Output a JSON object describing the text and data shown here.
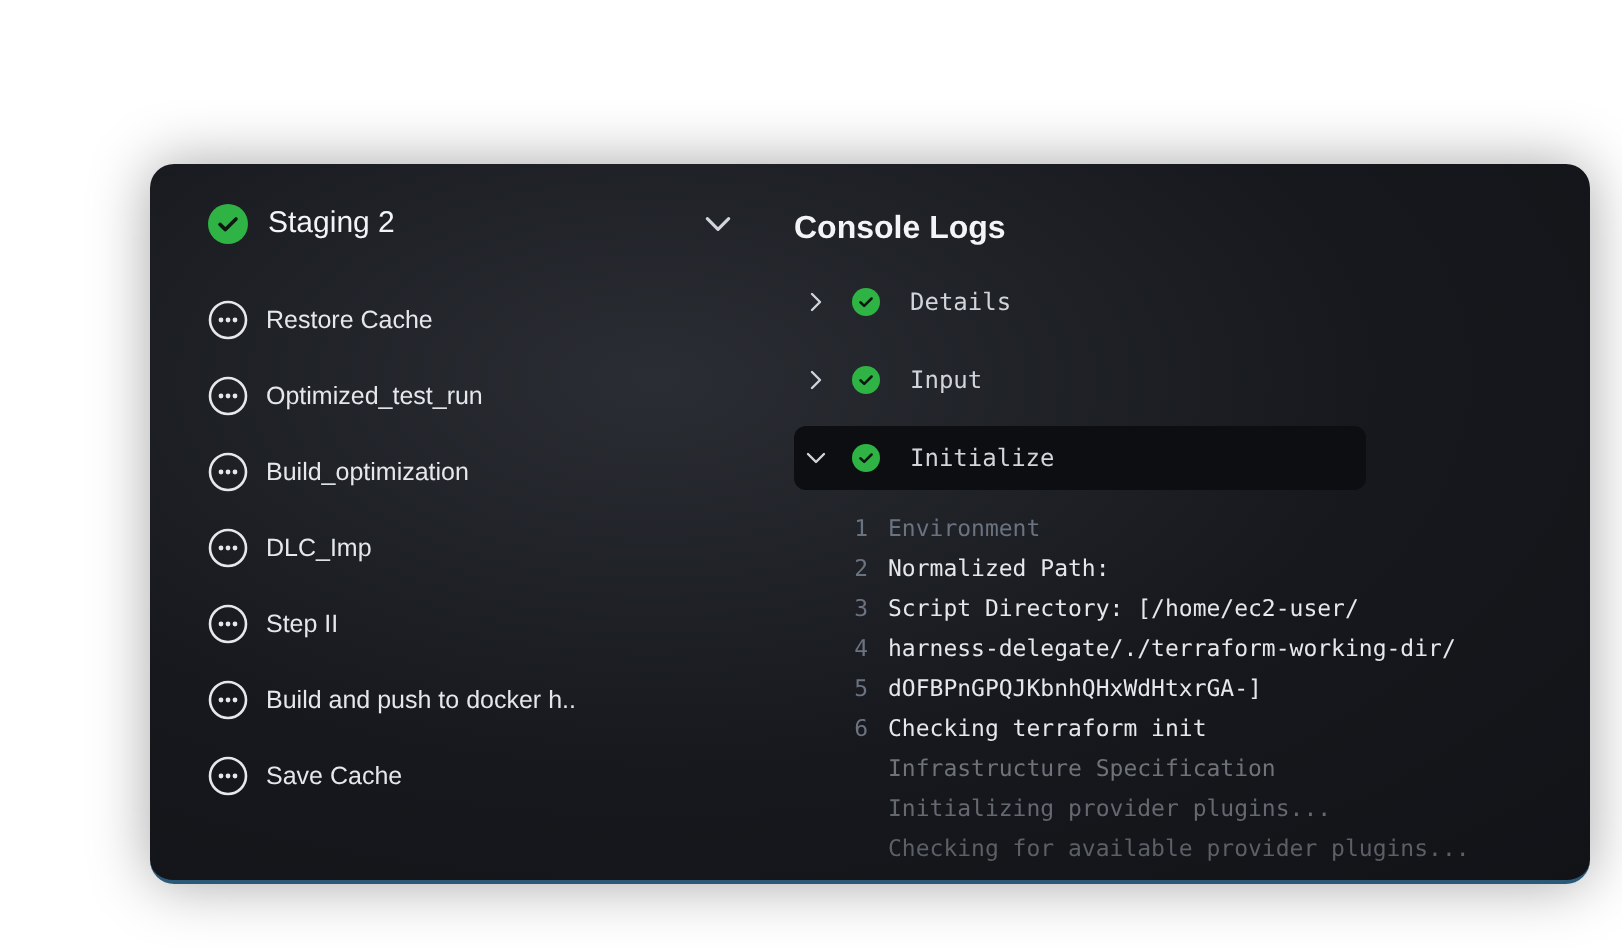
{
  "stage": {
    "title": "Staging 2",
    "kind": "success",
    "expanded": true
  },
  "steps": [
    {
      "label": "Restore Cache",
      "kind": "pending"
    },
    {
      "label": "Optimized_test_run",
      "kind": "pending"
    },
    {
      "label": "Build_optimization",
      "kind": "pending"
    },
    {
      "label": "DLC_Imp",
      "kind": "pending"
    },
    {
      "label": "Step II",
      "kind": "pending"
    },
    {
      "label": "Build and push to docker h..",
      "kind": "pending"
    },
    {
      "label": "Save Cache",
      "kind": "pending"
    }
  ],
  "console": {
    "title": "Console Logs",
    "sections": [
      {
        "label": "Details",
        "kind": "success",
        "expanded": false,
        "selected": false
      },
      {
        "label": "Input",
        "kind": "success",
        "expanded": false,
        "selected": false
      },
      {
        "label": "Initialize",
        "kind": "success",
        "expanded": true,
        "selected": true
      }
    ],
    "lines": [
      {
        "number": "1",
        "text": "Environment",
        "kind": "dim"
      },
      {
        "number": "2",
        "text": "Normalized Path:",
        "kind": "bright"
      },
      {
        "number": "3",
        "text": "Script Directory: [/home/ec2-user/",
        "kind": "bright"
      },
      {
        "number": "4",
        "text": "harness-delegate/./terraform-working-dir/",
        "kind": "bright"
      },
      {
        "number": "5",
        "text": "dOFBPnGPQJKbnhQHxWdHtxrGA-]",
        "kind": "bright"
      },
      {
        "number": "6",
        "text": "Checking terraform init",
        "kind": "bright"
      },
      {
        "text": "Infrastructure Specification",
        "kind": "fade1"
      },
      {
        "text": "Initializing provider plugins...",
        "kind": "fade2"
      },
      {
        "text": "Checking for available provider plugins...",
        "kind": "fade3"
      }
    ]
  }
}
